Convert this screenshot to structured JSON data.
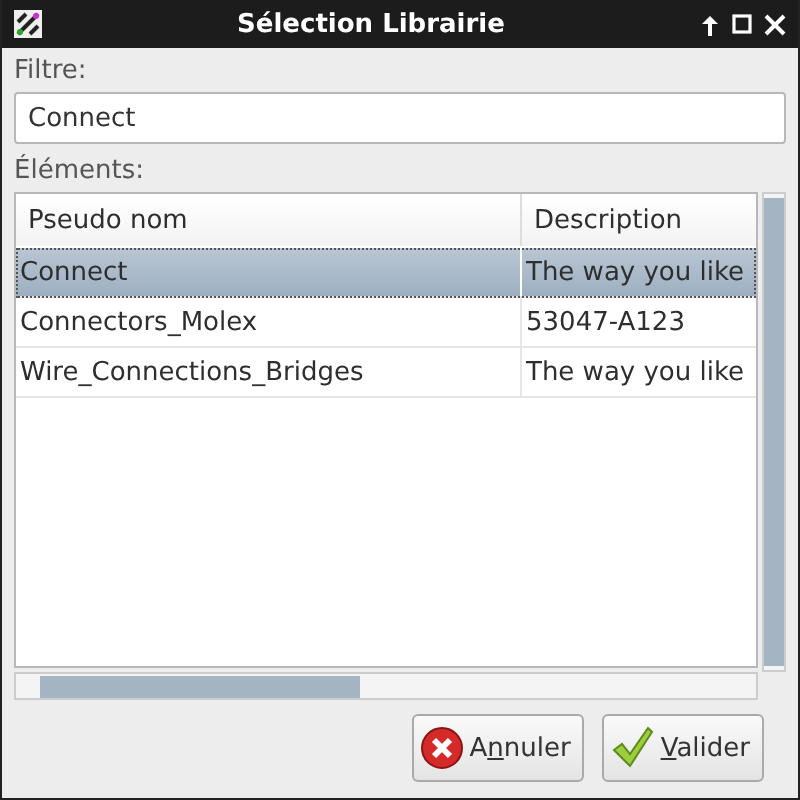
{
  "window": {
    "title": "Sélection Librairie"
  },
  "filter": {
    "label": "Filtre:",
    "value": "Connect"
  },
  "elements": {
    "label": "Éléments:",
    "columns": [
      "Pseudo nom",
      "Description"
    ],
    "rows": [
      {
        "cells": [
          "Connect",
          "The way you like"
        ],
        "selected": true
      },
      {
        "cells": [
          "Connectors_Molex",
          "53047-A123"
        ],
        "selected": false
      },
      {
        "cells": [
          "Wire_Connections_Bridges",
          "The way you like"
        ],
        "selected": false
      }
    ]
  },
  "buttons": [
    {
      "kind": "cancel",
      "before": "A",
      "key": "n",
      "after": "nuler"
    },
    {
      "kind": "ok",
      "key": "V",
      "after": "alider"
    }
  ]
}
